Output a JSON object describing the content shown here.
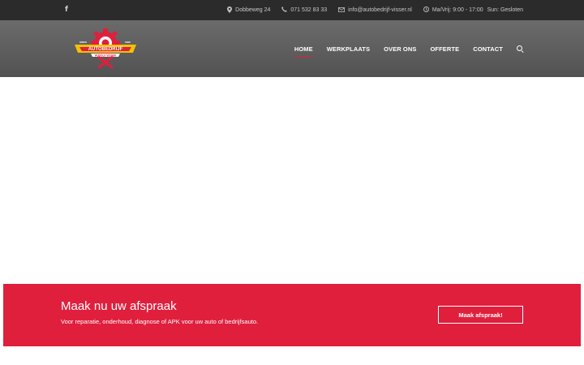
{
  "topbar": {
    "social": {
      "facebook_icon": "f"
    },
    "address": "Dobbeweg 24",
    "phone": "071 532 83 33",
    "email": "info@autobedrijf-visser.nl",
    "hours_weekday": "Ma/Vrij: 9:00 - 17:00",
    "hours_sunday": "Sun: Gesloten",
    "icons": [
      "map-marker-icon",
      "phone-icon",
      "envelope-icon",
      "clock-icon"
    ]
  },
  "logo": {
    "text": "AUTOBEDRIJF",
    "subtext": "RUDOLF VISSER",
    "since_left": "SINCE",
    "since_right": "1996"
  },
  "nav": {
    "items": [
      {
        "label": "HOME",
        "active": true
      },
      {
        "label": "WERKPLAATS",
        "active": false
      },
      {
        "label": "OVER ONS",
        "active": false
      },
      {
        "label": "OFFERTE",
        "active": false
      },
      {
        "label": "CONTACT",
        "active": false
      }
    ],
    "search_icon": "search-icon"
  },
  "cta": {
    "title": "Maak nu uw afspraak",
    "subtitle": "Voor reparatie, onderhoud, diagnose of APK voor uw auto of bedrijfsauto.",
    "button": "Maak afspraak!"
  },
  "colors": {
    "accent": "#e01f3d",
    "topbar": "#2b2b2b",
    "header": "#5e5e5e",
    "logo_yellow": "#f2c200"
  }
}
